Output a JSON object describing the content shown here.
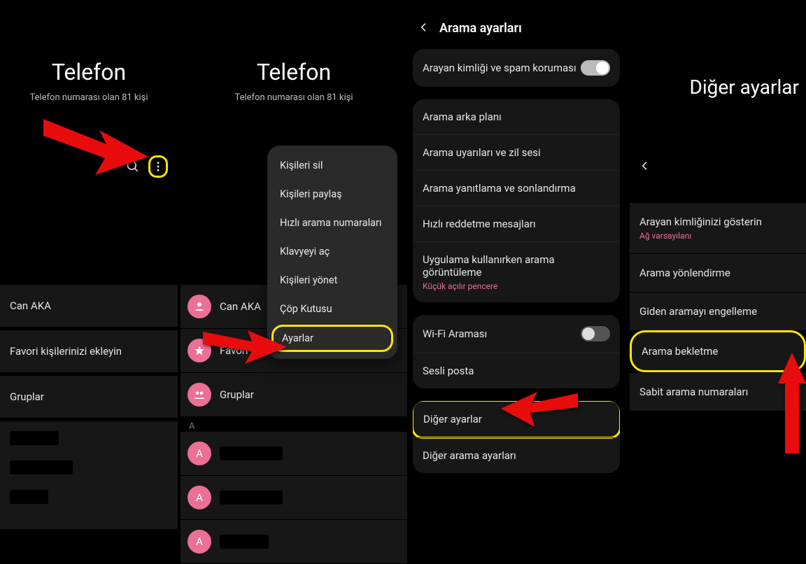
{
  "panel1": {
    "title": "Telefon",
    "subtitle": "Telefon numarası olan 81 kişi",
    "rows": [
      "Can AKA",
      "Favori kişilerinizi ekleyin",
      "Gruplar"
    ]
  },
  "panel2": {
    "title": "Telefon",
    "subtitle": "Telefon numarası olan 81 kişi",
    "rows": [
      "Can AKA",
      "Favori kiş",
      "Gruplar"
    ],
    "letter": "A",
    "avatar_letter": "A"
  },
  "menu": {
    "items": [
      "Kişileri sil",
      "Kişileri paylaş",
      "Hızlı arama numaraları",
      "Klavyeyi aç",
      "Kişileri yönet",
      "Çöp Kutusu",
      "Ayarlar"
    ]
  },
  "panel3": {
    "title": "Arama ayarları",
    "group1": {
      "label": "Arayan kimliği ve spam koruması"
    },
    "group2": {
      "items": [
        "Arama arka planı",
        "Arama uyarıları ve zil sesi",
        "Arama yanıtlama ve sonlandırma",
        "Hızlı reddetme mesajları"
      ],
      "last_label": "Uygulama kullanırken arama görüntüleme",
      "last_sub": "Küçük açılır pencere"
    },
    "group3": {
      "wifi": "Wi-Fi Araması",
      "voicemail": "Sesli posta"
    },
    "group4": {
      "other": "Diğer ayarlar",
      "other2": "Diğer arama ayarları"
    }
  },
  "panel4": {
    "title": "Diğer ayarlar",
    "items": {
      "caller_id": "Arayan kimliğinizi gösterin",
      "caller_id_sub": "Ağ varsayılanı",
      "forward": "Arama yönlendirme",
      "block": "Giden aramayı engelleme",
      "waiting": "Arama bekletme",
      "fixed": "Sabit arama numaraları"
    }
  }
}
